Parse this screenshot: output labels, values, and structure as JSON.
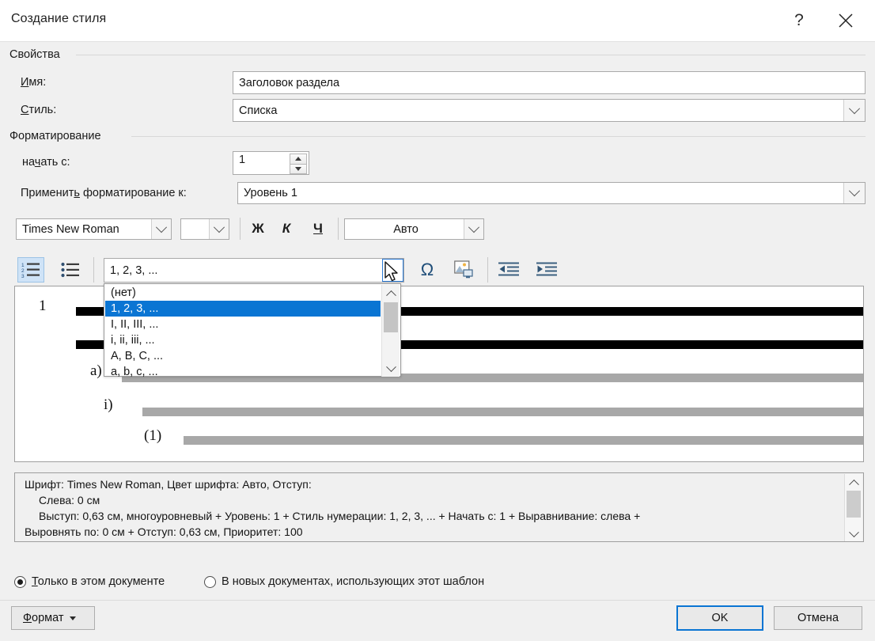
{
  "dialog": {
    "title": "Создание стиля",
    "help_icon": "?",
    "close_icon": "close-icon"
  },
  "groups": {
    "properties": "Свойства",
    "formatting": "Форматирование"
  },
  "properties": {
    "name_label": "Имя:",
    "name_value": "Заголовок раздела",
    "style_label": "Стиль:",
    "style_value": "Списка"
  },
  "formatting": {
    "start_label": "начать с:",
    "start_value": "1",
    "apply_label": "Применить форматирование к:",
    "apply_value": "Уровень 1"
  },
  "font_toolbar": {
    "font_family": "Times New Roman",
    "font_size": "",
    "bold": "Ж",
    "italic": "К",
    "underline": "Ч",
    "color_value": "Авто"
  },
  "list_toolbar": {
    "numbered_list_icon": "numbered-list-icon",
    "bulleted_list_icon": "bulleted-list-icon",
    "number_style_value": "1, 2, 3, ...",
    "symbol_icon": "Ω",
    "picture_icon": "insert-picture-icon",
    "decrease_indent_icon": "decrease-indent-icon",
    "increase_indent_icon": "increase-indent-icon"
  },
  "dropdown": {
    "open": true,
    "items": [
      "(нет)",
      "1, 2, 3, ...",
      "I, II, III, ...",
      "i, ii, iii, ...",
      "A, B, C, ...",
      "a, b, c, ..."
    ],
    "selected_index": 1
  },
  "preview": {
    "levels": [
      {
        "marker": "1"
      },
      {
        "marker": "a)"
      },
      {
        "marker": "i)"
      },
      {
        "marker": "(1)"
      }
    ]
  },
  "description": {
    "lines": [
      "Шрифт: Times New Roman, Цвет шрифта: Авто, Отступ:",
      "Слева:  0 см",
      "Выступ:  0,63 см, многоуровневый + Уровень: 1 + Стиль нумерации: 1, 2, 3, ... + Начать с: 1 + Выравнивание: слева +",
      "Выровнять по:  0 см + Отступ:  0,63 см, Приоритет: 100"
    ]
  },
  "scope": {
    "option_this_doc": "Только в этом документе",
    "option_new_docs": "В новых документах, использующих этот шаблон",
    "selected": "this_doc"
  },
  "footer": {
    "format_button": "Формат",
    "ok_button": "OK",
    "cancel_button": "Отмена"
  },
  "colors": {
    "accent": "#0a75d3",
    "dialog_bg": "#f0f0f0",
    "preview_black": "#000000",
    "preview_gray": "#a8a8a8"
  }
}
